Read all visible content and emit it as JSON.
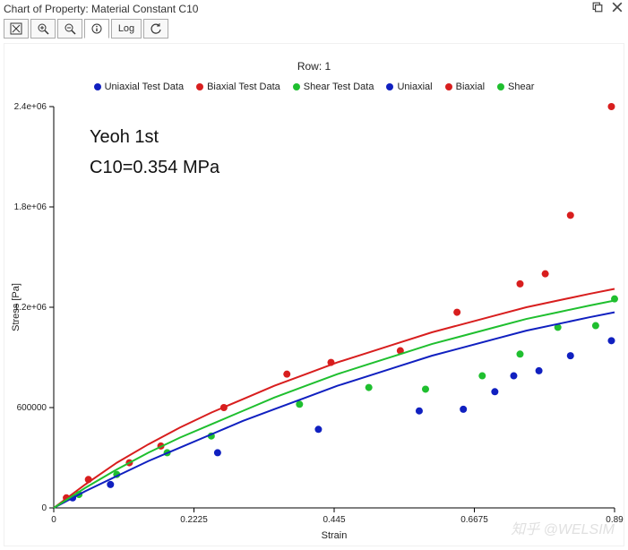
{
  "window": {
    "title": "Chart of Property: Material Constant C10"
  },
  "toolbar": {
    "fit_tip": "Fit",
    "zoom_in_tip": "Zoom In",
    "zoom_out_tip": "Zoom Out",
    "info_tip": "Info",
    "log_label": "Log",
    "refresh_tip": "Refresh"
  },
  "chart_data": {
    "type": "scatter",
    "title": "Row: 1",
    "xlabel": "Strain",
    "ylabel": "Stress [Pa]",
    "xlim": [
      0,
      0.89
    ],
    "ylim": [
      0,
      2400000.0
    ],
    "xticks": [
      0,
      0.2225,
      0.445,
      0.6675,
      0.89
    ],
    "yticks": [
      0,
      600000,
      1200000.0,
      1800000.0,
      2400000.0
    ],
    "ytick_labels": [
      "0",
      "600000",
      "1.2e+06",
      "1.8e+06",
      "2.4e+06"
    ],
    "annotations": [
      "Yeoh 1st",
      "C10=0.354 MPa"
    ],
    "legend": [
      {
        "name": "Uniaxial Test Data",
        "type": "scatter",
        "color": "#1020c0"
      },
      {
        "name": "Biaxial Test Data",
        "type": "scatter",
        "color": "#d81e1e"
      },
      {
        "name": "Shear Test Data",
        "type": "scatter",
        "color": "#1fbf2f"
      },
      {
        "name": "Uniaxial",
        "type": "line",
        "color": "#1020c0"
      },
      {
        "name": "Biaxial",
        "type": "line",
        "color": "#d81e1e"
      },
      {
        "name": "Shear",
        "type": "line",
        "color": "#1fbf2f"
      }
    ],
    "series": [
      {
        "name": "Uniaxial Test Data",
        "type": "scatter",
        "color": "#1020c0",
        "x": [
          0.03,
          0.09,
          0.26,
          0.42,
          0.58,
          0.65,
          0.7,
          0.73,
          0.77,
          0.82,
          0.885
        ],
        "y": [
          60000,
          140000,
          330000,
          470000,
          580000,
          590000,
          695000,
          790000,
          820000,
          910000,
          1000000
        ]
      },
      {
        "name": "Biaxial Test Data",
        "type": "scatter",
        "color": "#d81e1e",
        "x": [
          0.02,
          0.055,
          0.12,
          0.17,
          0.27,
          0.37,
          0.44,
          0.55,
          0.64,
          0.74,
          0.78,
          0.82,
          0.885
        ],
        "y": [
          60000,
          170000,
          270000,
          370000,
          600000,
          800000,
          870000,
          940000,
          1170000,
          1340000,
          1400000,
          1750000,
          2400000
        ]
      },
      {
        "name": "Shear Test Data",
        "type": "scatter",
        "color": "#1fbf2f",
        "x": [
          0.04,
          0.1,
          0.18,
          0.25,
          0.39,
          0.5,
          0.59,
          0.68,
          0.74,
          0.8,
          0.86,
          0.89
        ],
        "y": [
          80000,
          200000,
          330000,
          430000,
          620000,
          720000,
          710000,
          790000,
          920000,
          1080000,
          1090000,
          1250000
        ]
      },
      {
        "name": "Uniaxial",
        "type": "line",
        "color": "#1020c0",
        "x": [
          0,
          0.05,
          0.1,
          0.15,
          0.2,
          0.25,
          0.3,
          0.35,
          0.4,
          0.45,
          0.5,
          0.55,
          0.6,
          0.65,
          0.7,
          0.75,
          0.8,
          0.85,
          0.89
        ],
        "y": [
          0,
          100000,
          190000,
          280000,
          360000,
          440000,
          520000,
          590000,
          660000,
          730000,
          790000,
          850000,
          910000,
          960000,
          1010000,
          1060000,
          1100000,
          1140000,
          1170000
        ]
      },
      {
        "name": "Biaxial",
        "type": "line",
        "color": "#d81e1e",
        "x": [
          0,
          0.05,
          0.1,
          0.15,
          0.2,
          0.25,
          0.3,
          0.35,
          0.4,
          0.45,
          0.5,
          0.55,
          0.6,
          0.65,
          0.7,
          0.75,
          0.8,
          0.85,
          0.89
        ],
        "y": [
          0,
          140000,
          270000,
          380000,
          480000,
          570000,
          650000,
          730000,
          800000,
          870000,
          930000,
          990000,
          1050000,
          1100000,
          1150000,
          1200000,
          1240000,
          1280000,
          1310000
        ]
      },
      {
        "name": "Shear",
        "type": "line",
        "color": "#1fbf2f",
        "x": [
          0,
          0.05,
          0.1,
          0.15,
          0.2,
          0.25,
          0.3,
          0.35,
          0.4,
          0.45,
          0.5,
          0.55,
          0.6,
          0.65,
          0.7,
          0.75,
          0.8,
          0.85,
          0.89
        ],
        "y": [
          0,
          120000,
          230000,
          330000,
          420000,
          500000,
          580000,
          660000,
          730000,
          800000,
          860000,
          920000,
          980000,
          1030000,
          1080000,
          1130000,
          1170000,
          1210000,
          1240000
        ]
      }
    ]
  },
  "watermark": "知乎 @WELSIM"
}
